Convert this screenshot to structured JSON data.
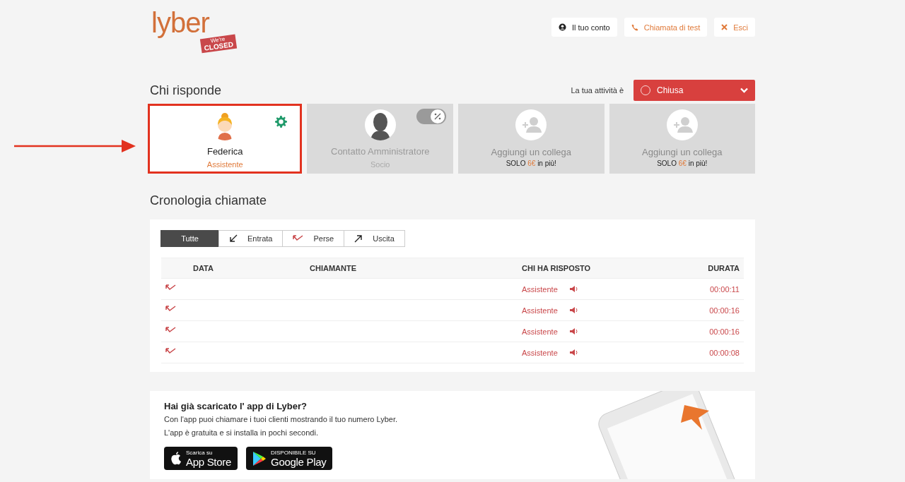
{
  "logo": {
    "brand": "lyber",
    "badge_top": "We're",
    "badge": "CLOSED"
  },
  "header_buttons": [
    {
      "kind": "account",
      "label": "Il tuo conto"
    },
    {
      "kind": "test-call",
      "label": "Chiamata di test"
    },
    {
      "kind": "logout",
      "label": "Esci"
    }
  ],
  "team": {
    "title": "Chi risponde",
    "activity_label": "La tua attività è",
    "activity_status": "Chiusa",
    "cards": [
      {
        "kind": "member",
        "name": "Federica",
        "role": "Assistente",
        "highlighted": true,
        "disabled": false,
        "toggle": false
      },
      {
        "kind": "member",
        "name": "Contatto Amministratore",
        "role": "Socio",
        "highlighted": false,
        "disabled": true,
        "toggle": true
      },
      {
        "kind": "add",
        "title": "Aggiungi un collega",
        "price_prefix": "SOLO",
        "price": "6€",
        "price_suffix": "in più!"
      },
      {
        "kind": "add",
        "title": "Aggiungi un collega",
        "price_prefix": "SOLO",
        "price": "6€",
        "price_suffix": "in più!"
      }
    ]
  },
  "history": {
    "title": "Cronologia chiamate",
    "tabs": [
      {
        "kind": "all",
        "label": "Tutte",
        "selected": true
      },
      {
        "kind": "in",
        "label": "Entrata",
        "selected": false
      },
      {
        "kind": "missed",
        "label": "Perse",
        "selected": false
      },
      {
        "kind": "out",
        "label": "Uscita",
        "selected": false
      }
    ],
    "columns": [
      "DATA",
      "CHIAMANTE",
      "CHI HA RISPOSTO",
      "DURATA"
    ],
    "rows": [
      {
        "kind": "missed",
        "answered_by": "Assistente",
        "duration": "00:00:11"
      },
      {
        "kind": "missed",
        "answered_by": "Assistente",
        "duration": "00:00:16"
      },
      {
        "kind": "missed",
        "answered_by": "Assistente",
        "duration": "00:00:16"
      },
      {
        "kind": "missed",
        "answered_by": "Assistente",
        "duration": "00:00:08"
      }
    ]
  },
  "app_promo": {
    "title": "Hai già scaricato l' app di Lyber?",
    "lines": [
      "Con l'app puoi chiamare i tuoi clienti mostrando il tuo numero Lyber.",
      "L'app è gratuita e si installa in pochi secondi."
    ],
    "stores": [
      {
        "kind": "apple",
        "small": "Scarica su",
        "big": "App Store"
      },
      {
        "kind": "google",
        "small": "DISPONIBILE SU",
        "big": "Google Play"
      }
    ]
  }
}
